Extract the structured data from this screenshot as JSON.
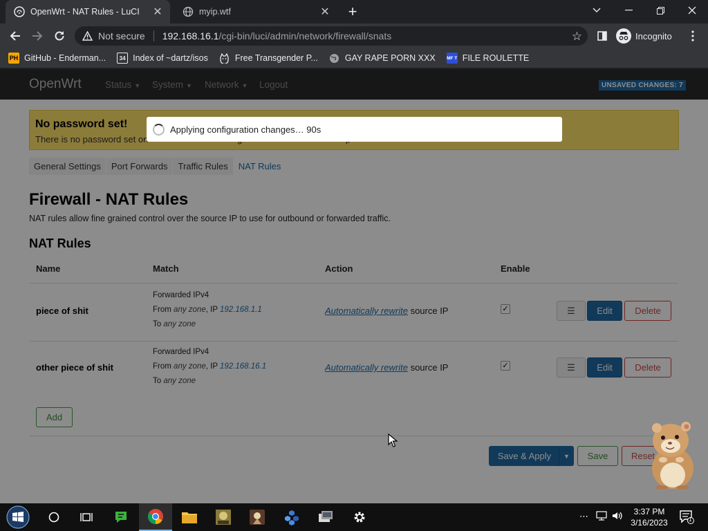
{
  "browser": {
    "tabs": [
      {
        "title": "OpenWrt - NAT Rules - LuCI",
        "active": true
      },
      {
        "title": "myip.wtf",
        "active": false
      }
    ],
    "security_label": "Not secure",
    "url_host": "192.168.16.1",
    "url_path": "/cgi-bin/luci/admin/network/firewall/snats",
    "profile_label": "Incognito",
    "bookmarks": [
      {
        "label": "GitHub - Enderman...",
        "icon": "PH"
      },
      {
        "label": "Index of ~dartz/isos",
        "icon": "34"
      },
      {
        "label": "Free Transgender P...",
        "icon": "cat-icon"
      },
      {
        "label": "GAY RAPE PORN XXX",
        "icon": "globe-icon"
      },
      {
        "label": "FILE ROULETTE",
        "icon": "MF T"
      }
    ]
  },
  "luci": {
    "brand": "OpenWrt",
    "menu": [
      "Status",
      "System",
      "Network",
      "Logout"
    ],
    "unsaved_badge": "UNSAVED CHANGES: 7",
    "alert_title": "No password set!",
    "alert_text": "There is no password set on",
    "alert_text_tail": "g",
    "alert_text_tail2": "p",
    "subtabs": [
      "General Settings",
      "Port Forwards",
      "Traffic Rules",
      "NAT Rules"
    ],
    "page_title": "Firewall - NAT Rules",
    "page_description": "NAT rules allow fine grained control over the source IP to use for outbound or forwarded traffic.",
    "section_title": "NAT Rules",
    "columns": {
      "name": "Name",
      "match": "Match",
      "action": "Action",
      "enable": "Enable"
    },
    "rules": [
      {
        "name": "piece of shit",
        "match_proto": "Forwarded IPv4",
        "from_label": "From",
        "from_zone": "any zone",
        "ip_label": ", IP",
        "ip": "192.168.1.1",
        "to_label": "To",
        "to_zone": "any zone",
        "action_link": "Automatically rewrite",
        "action_tail": "source IP",
        "enabled": true
      },
      {
        "name": "other piece of shit",
        "match_proto": "Forwarded IPv4",
        "from_label": "From",
        "from_zone": "any zone",
        "ip_label": ", IP",
        "ip": "192.168.16.1",
        "to_label": "To",
        "to_zone": "any zone",
        "action_link": "Automatically rewrite",
        "action_tail": "source IP",
        "enabled": true
      }
    ],
    "row_buttons": {
      "drag": "☰",
      "edit": "Edit",
      "delete": "Delete"
    },
    "add_label": "Add",
    "save_apply_label": "Save & Apply",
    "save_label": "Save",
    "reset_label": "Reset",
    "modal_text": "Applying configuration changes… 90s"
  },
  "taskbar": {
    "time": "3:37 PM",
    "date": "3/16/2023",
    "notification_count": "1"
  },
  "colors": {
    "luci_blue": "#1f6aa5",
    "alert_yellow": "#ffe26b",
    "chrome_dark": "#202124",
    "chrome_toolbar": "#35363a"
  }
}
